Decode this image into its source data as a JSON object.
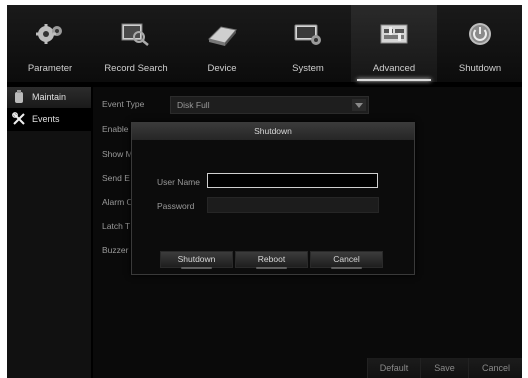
{
  "topnav": {
    "items": [
      {
        "label": "Parameter",
        "icon": "gears-icon"
      },
      {
        "label": "Record Search",
        "icon": "record-search-icon"
      },
      {
        "label": "Device",
        "icon": "hard-drive-icon"
      },
      {
        "label": "System",
        "icon": "system-monitor-icon"
      },
      {
        "label": "Advanced",
        "icon": "advanced-settings-icon"
      },
      {
        "label": "Shutdown",
        "icon": "power-icon"
      }
    ],
    "active": "Advanced"
  },
  "sidebar": {
    "items": [
      {
        "label": "Maintain",
        "icon": "maintain-icon"
      },
      {
        "label": "Events",
        "icon": "tools-icon"
      }
    ],
    "selected": "Events"
  },
  "main": {
    "event_type_label": "Event Type",
    "event_type_value": "Disk Full",
    "rows": [
      "Enable",
      "Show M",
      "Send E",
      "Alarm O",
      "Latch T",
      "Buzzer"
    ],
    "buttons": {
      "default": "Default",
      "save": "Save",
      "cancel": "Cancel"
    }
  },
  "dialog": {
    "title": "Shutdown",
    "username_label": "User Name",
    "password_label": "Password",
    "username_value": "",
    "password_value": "",
    "buttons": {
      "shutdown": "Shutdown",
      "reboot": "Reboot",
      "cancel": "Cancel"
    }
  },
  "colors": {
    "background": "#000000",
    "text": "#9a9a9a",
    "highlight": "#dcdcdc"
  }
}
